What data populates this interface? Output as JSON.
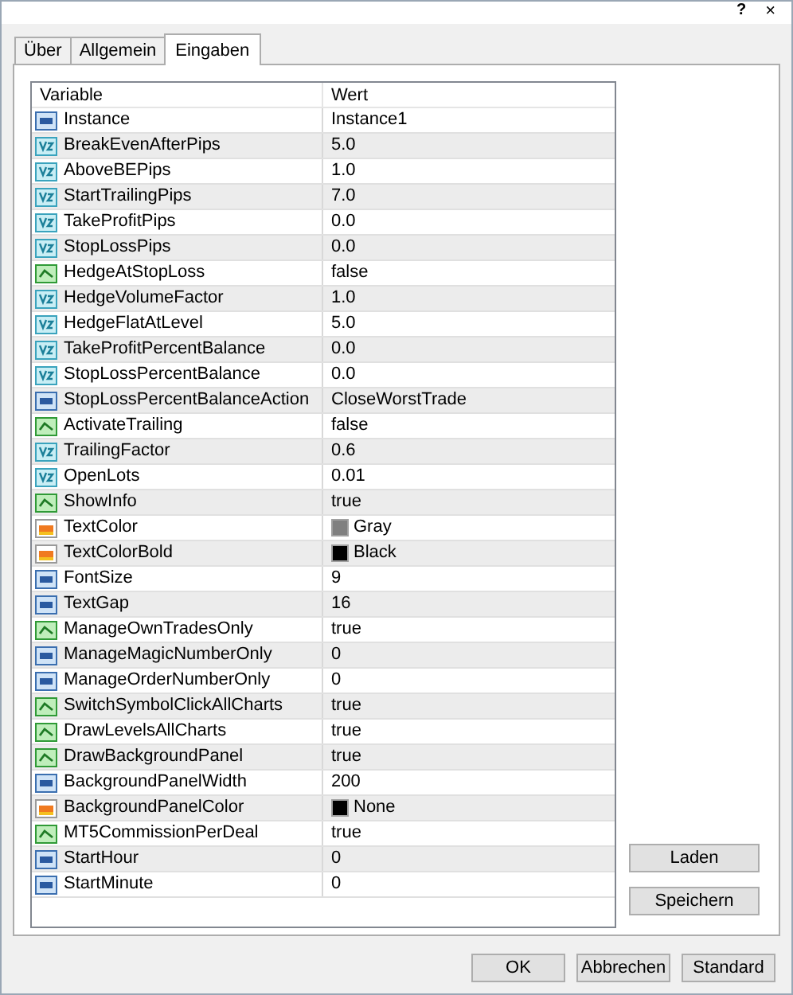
{
  "title_bar": {
    "help": "?",
    "close": "×"
  },
  "tabs": [
    {
      "label": "Über",
      "selected": false
    },
    {
      "label": "Allgemein",
      "selected": false
    },
    {
      "label": "Eingaben",
      "selected": true
    }
  ],
  "table": {
    "columns": [
      "Variable",
      "Wert"
    ],
    "rows": [
      {
        "kind": "int",
        "name": "Instance",
        "value": "Instance1"
      },
      {
        "kind": "double",
        "name": "BreakEvenAfterPips",
        "value": "5.0"
      },
      {
        "kind": "double",
        "name": "AboveBEPips",
        "value": "1.0"
      },
      {
        "kind": "double",
        "name": "StartTrailingPips",
        "value": "7.0"
      },
      {
        "kind": "double",
        "name": "TakeProfitPips",
        "value": "0.0"
      },
      {
        "kind": "double",
        "name": "StopLossPips",
        "value": "0.0"
      },
      {
        "kind": "bool",
        "name": "HedgeAtStopLoss",
        "value": "false"
      },
      {
        "kind": "double",
        "name": "HedgeVolumeFactor",
        "value": "1.0"
      },
      {
        "kind": "double",
        "name": "HedgeFlatAtLevel",
        "value": "5.0"
      },
      {
        "kind": "double",
        "name": "TakeProfitPercentBalance",
        "value": "0.0"
      },
      {
        "kind": "double",
        "name": "StopLossPercentBalance",
        "value": "0.0"
      },
      {
        "kind": "int",
        "name": "StopLossPercentBalanceAction",
        "value": "CloseWorstTrade"
      },
      {
        "kind": "bool",
        "name": "ActivateTrailing",
        "value": "false"
      },
      {
        "kind": "double",
        "name": "TrailingFactor",
        "value": "0.6"
      },
      {
        "kind": "double",
        "name": "OpenLots",
        "value": "0.01"
      },
      {
        "kind": "bool",
        "name": "ShowInfo",
        "value": "true"
      },
      {
        "kind": "color",
        "name": "TextColor",
        "value": "Gray",
        "color": "#808080"
      },
      {
        "kind": "color",
        "name": "TextColorBold",
        "value": "Black",
        "color": "#000000"
      },
      {
        "kind": "int",
        "name": "FontSize",
        "value": "9"
      },
      {
        "kind": "int",
        "name": "TextGap",
        "value": "16"
      },
      {
        "kind": "bool",
        "name": "ManageOwnTradesOnly",
        "value": "true"
      },
      {
        "kind": "int",
        "name": "ManageMagicNumberOnly",
        "value": "0"
      },
      {
        "kind": "int",
        "name": "ManageOrderNumberOnly",
        "value": "0"
      },
      {
        "kind": "bool",
        "name": "SwitchSymbolClickAllCharts",
        "value": "true"
      },
      {
        "kind": "bool",
        "name": "DrawLevelsAllCharts",
        "value": "true"
      },
      {
        "kind": "bool",
        "name": "DrawBackgroundPanel",
        "value": "true"
      },
      {
        "kind": "int",
        "name": "BackgroundPanelWidth",
        "value": "200"
      },
      {
        "kind": "color",
        "name": "BackgroundPanelColor",
        "value": "None",
        "color": "#000000"
      },
      {
        "kind": "bool",
        "name": "MT5CommissionPerDeal",
        "value": "true"
      },
      {
        "kind": "int",
        "name": "StartHour",
        "value": "0"
      },
      {
        "kind": "int",
        "name": "StartMinute",
        "value": "0"
      }
    ]
  },
  "side_buttons": [
    "Laden",
    "Speichern"
  ],
  "buttons": [
    "OK",
    "Abbrechen",
    "Standard"
  ]
}
